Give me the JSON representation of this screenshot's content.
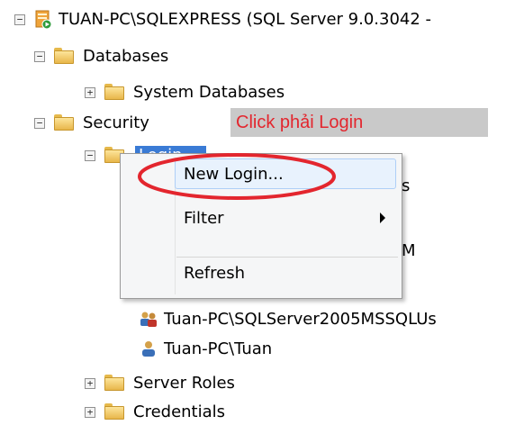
{
  "tree": {
    "server_label": "TUAN-PC\\SQLEXPRESS (SQL Server 9.0.3042 -",
    "databases": "Databases",
    "system_databases": "System Databases",
    "security": "Security",
    "login": "Login",
    "partial_right_1": "s",
    "partial_right_2": "M",
    "user_1": "Tuan-PC\\SQLServer2005MSSQLUs",
    "user_2": "Tuan-PC\\Tuan",
    "server_roles": "Server Roles",
    "credentials": "Credentials"
  },
  "annotation": {
    "text": "Click phải Login"
  },
  "context_menu": {
    "new_login": "New Login...",
    "filter": "Filter",
    "refresh": "Refresh"
  },
  "colors": {
    "annotation_text": "#e3262e",
    "ellipse": "#e3262e",
    "selection": "#3a7bd5"
  },
  "icons": {
    "server": "server-running-icon",
    "folder": "folder-icon",
    "user_group": "user-group-icon",
    "user": "user-icon"
  }
}
